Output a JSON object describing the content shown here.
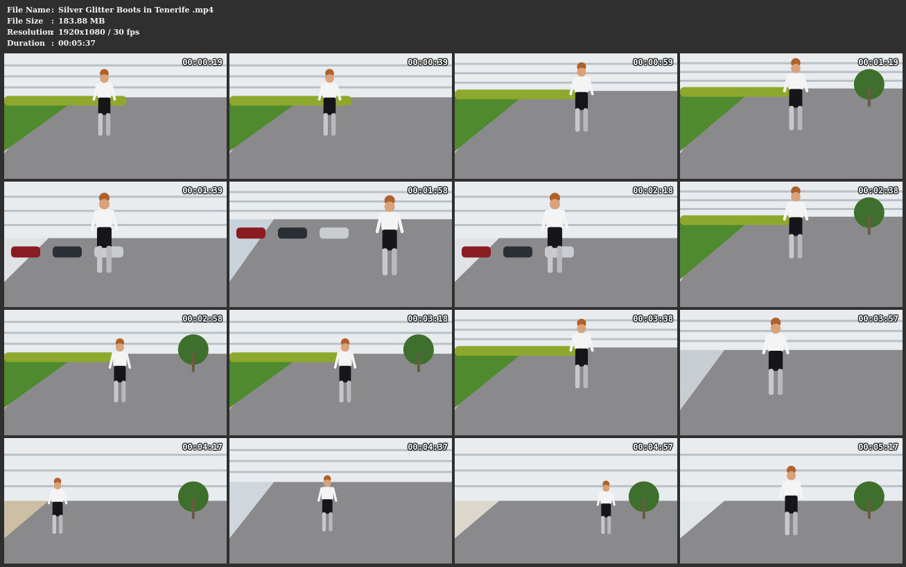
{
  "file_info": {
    "name_label": "File Name",
    "name_value": "Silver Glitter Boots in Tenerife .mp4",
    "size_label": "File Size",
    "size_value": "183.88 MB",
    "resolution_label": "Resolution",
    "resolution_value": "1920x1080 / 30 fps",
    "duration_label": "Duration",
    "duration_value": "00:05:37",
    "separator": ":"
  },
  "thumbnails": [
    {
      "time": "00:00:19",
      "scene": "promenade-lawn"
    },
    {
      "time": "00:00:39",
      "scene": "promenade-lawn"
    },
    {
      "time": "00:00:59",
      "scene": "promenade-walkers"
    },
    {
      "time": "00:01:19",
      "scene": "promenade-palm"
    },
    {
      "time": "00:01:39",
      "scene": "parking-building"
    },
    {
      "time": "00:01:58",
      "scene": "parking-cars"
    },
    {
      "time": "00:02:18",
      "scene": "parking-building"
    },
    {
      "time": "00:02:38",
      "scene": "promenade-palm"
    },
    {
      "time": "00:02:58",
      "scene": "promenade-hills"
    },
    {
      "time": "00:03:18",
      "scene": "promenade-hills"
    },
    {
      "time": "00:03:38",
      "scene": "promenade-walkers"
    },
    {
      "time": "00:03:57",
      "scene": "plaza-hotel"
    },
    {
      "time": "00:04:17",
      "scene": "street-wall"
    },
    {
      "time": "00:04:37",
      "scene": "mural-wall"
    },
    {
      "time": "00:04:57",
      "scene": "tree-railing"
    },
    {
      "time": "00:05:17",
      "scene": "ramp-building"
    }
  ],
  "colors": {
    "background": "#2f2f2f",
    "header_text": "#f0f0f0",
    "timestamp_text": "#ffffff",
    "pavement": "#8a8a8c",
    "grass": "#4f8a2f",
    "building": "#e9ecef",
    "sky": "#c9d3da"
  }
}
